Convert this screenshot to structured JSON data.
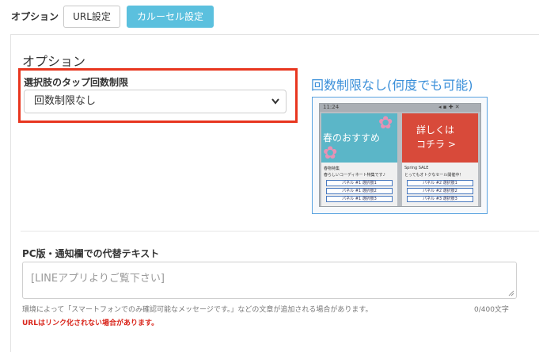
{
  "toolbar": {
    "label": "オプション",
    "tabs": [
      {
        "label": "URL設定"
      },
      {
        "label": "カルーセル設定"
      }
    ]
  },
  "options": {
    "section_title": "オプション",
    "tap_limit_label": "選択肢のタップ回数制限",
    "tap_limit_value": "回数制限なし"
  },
  "preview": {
    "title": "回数制限なし(何度でも可能)",
    "status_left": "11:24",
    "card1": {
      "image_text": "春のおすすめ",
      "caption1": "春物特集",
      "caption2": "春らしいコーディネート特集です♪",
      "buttons": [
        "パネル #1 選択肢1",
        "パネル #1 選択肢2",
        "パネル #1 選択肢3"
      ]
    },
    "card2": {
      "image_text1": "詳しくは",
      "image_text2": "コチラ >",
      "caption1": "Spring SALE",
      "caption2": "とってもオトクなセール開催中！",
      "buttons": [
        "パネル #2 選択肢1",
        "パネル #2 選択肢2",
        "パネル #3 選択肢3"
      ]
    }
  },
  "alt_text": {
    "label": "PC版・通知欄での代替テキスト",
    "placeholder": "[LINEアプリよりご覧下さい]",
    "help": "環境によって「スマートフォンでのみ確認可能なメッセージです。」などの文章が追加される場合があります。",
    "counter": "0/400文字",
    "warning": "URLはリンク化されない場合があります。"
  },
  "colors": {
    "accent": "#5bc0de",
    "highlight_border": "#e8361f",
    "preview_title": "#3a8fd9",
    "warning": "#d9261c"
  }
}
